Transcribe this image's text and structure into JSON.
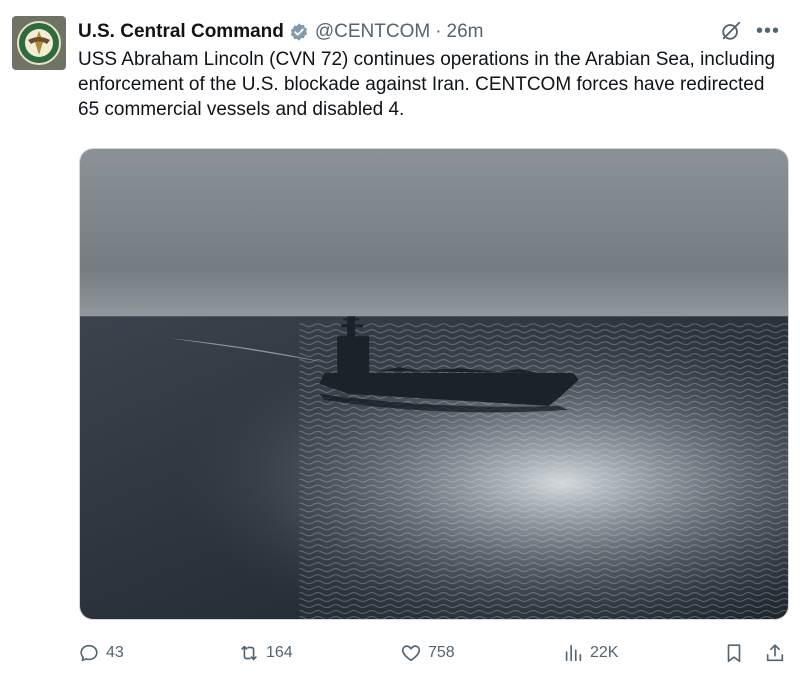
{
  "tweet": {
    "author_name": "U.S. Central Command",
    "handle": "@CENTCOM",
    "separator": "·",
    "time": "26m",
    "text": "USS Abraham Lincoln (CVN 72) continues operations in the Arabian Sea, including enforcement of the U.S. blockade against Iran. CENTCOM forces have redirected 65 commercial vessels and disabled 4.",
    "verified_color": "#829aab",
    "media_icon": "aircraft-carrier-photo"
  },
  "icons": {
    "avatar": "centcom-emblem-icon",
    "verified": "verified-badge-icon",
    "grok": "grok-icon",
    "more": "more-icon"
  },
  "actions": {
    "replies": "43",
    "reposts": "164",
    "likes": "758",
    "views": "22K"
  }
}
